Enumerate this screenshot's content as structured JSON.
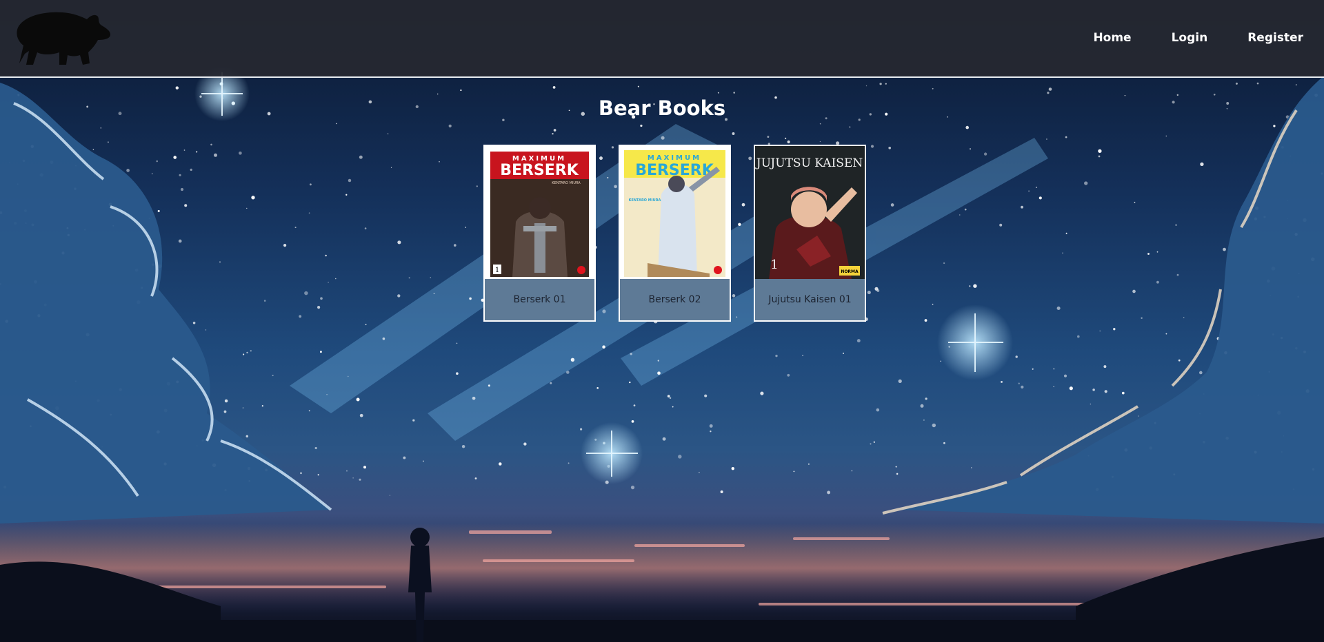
{
  "header": {
    "nav": {
      "home": "Home",
      "login": "Login",
      "register": "Register"
    },
    "logo_icon": "bear-silhouette-icon"
  },
  "main": {
    "title": "Bear Books",
    "books": [
      {
        "title": "Berserk 01",
        "cover_series": "BERSERK",
        "cover_brand": "MAXIMUM",
        "cover_author": "KENTARO MIURA",
        "cover_volume": "1"
      },
      {
        "title": "Berserk 02",
        "cover_series": "BERSERK",
        "cover_brand": "MAXIMUM",
        "cover_author": "KENTARO MIURA"
      },
      {
        "title": "Jujutsu Kaisen 01",
        "cover_series": "JUJUTSU KAISEN",
        "cover_volume": "1",
        "cover_publisher": "NORMA"
      }
    ]
  },
  "colors": {
    "header_bg": "#26282f",
    "card_label_bg": "#5e7a96",
    "card_border": "#ffffff",
    "title_text": "#ffffff"
  }
}
